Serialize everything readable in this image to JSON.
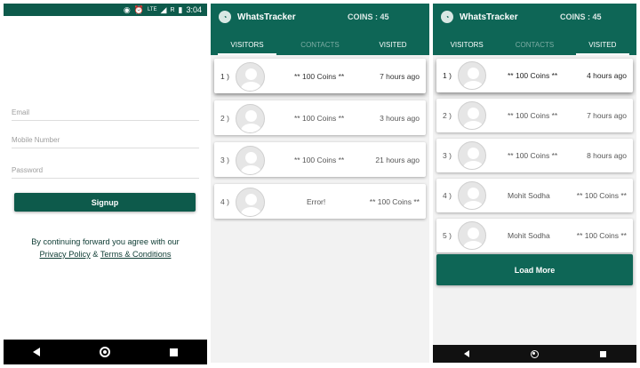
{
  "signup": {
    "status_icons": {
      "hotspot": "◉",
      "alarm": "⏰",
      "lte": "LTE",
      "signal": "◢",
      "roaming": "R",
      "battery": "▮"
    },
    "status_time": "3:04",
    "email_placeholder": "Email",
    "mobile_placeholder": "Mobile Number",
    "password_placeholder": "Password",
    "signup_label": "Signup",
    "terms_line1": "By continuing forward you agree with our",
    "privacy_link": "Privacy Policy",
    "amp": "&",
    "terms_link": "Terms & Conditions"
  },
  "visitors_screen": {
    "app_title": "WhatsTracker",
    "coins": "COINS : 45",
    "tabs": [
      "VISITORS",
      "CONTACTS",
      "VISITED"
    ],
    "rows": [
      {
        "index": "1 )",
        "coins": "** 100 Coins **",
        "time": "7 hours ago"
      },
      {
        "index": "2 )",
        "coins": "** 100 Coins **",
        "time": "3 hours ago"
      },
      {
        "index": "3 )",
        "coins": "** 100 Coins **",
        "time": "21 hours ago"
      },
      {
        "index": "4 )",
        "name": "Error!",
        "coins": "** 100 Coins **"
      }
    ]
  },
  "visited_screen": {
    "app_title": "WhatsTracker",
    "coins": "COINS : 45",
    "tabs": [
      "VISITORS",
      "CONTACTS",
      "VISITED"
    ],
    "rows": [
      {
        "index": "1 )",
        "coins": "** 100 Coins **",
        "time": "4 hours ago"
      },
      {
        "index": "2 )",
        "coins": "** 100 Coins **",
        "time": "7 hours ago"
      },
      {
        "index": "3 )",
        "coins": "** 100 Coins **",
        "time": "8 hours ago"
      },
      {
        "index": "4 )",
        "name": "Mohit Sodha",
        "coins": "** 100 Coins **"
      },
      {
        "index": "5 )",
        "name": "Mohit Sodha",
        "coins": "** 100 Coins **"
      }
    ],
    "load_more": "Load More"
  },
  "colors": {
    "primary": "#0e6656",
    "primary_dark": "#0d5a4b"
  }
}
